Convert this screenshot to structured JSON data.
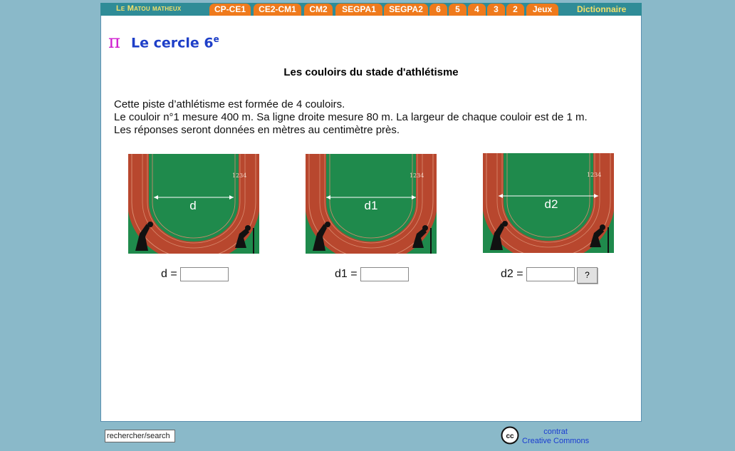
{
  "nav": {
    "site": "Le Matou matheux",
    "tabs": [
      "CP-CE1",
      "CE2-CM1",
      "CM2",
      "SEGPA1",
      "SEGPA2",
      "6",
      "5",
      "4",
      "3",
      "2",
      "Jeux"
    ],
    "dictionary": "Dictionnaire"
  },
  "page": {
    "pi_symbol": "π",
    "title": "Le cercle 6",
    "title_sup": "e",
    "subtitle": "Les couloirs du stade d'athlétisme",
    "lines": [
      "Cette piste d’athlétisme est formée de 4 couloirs.",
      "Le couloir n°1 mesure 400 m. Sa ligne droite mesure 80 m. La largeur de chaque couloir est de 1 m.",
      "Les réponses seront données en mètres au centimètre près."
    ]
  },
  "figures": [
    {
      "label": "d",
      "lanes": "1234"
    },
    {
      "label": "d1",
      "lanes": "1234"
    },
    {
      "label": "d2",
      "lanes": "1234"
    }
  ],
  "answers": [
    {
      "label": "d =",
      "value": ""
    },
    {
      "label": "d1 =",
      "value": ""
    },
    {
      "label": "d2 =",
      "value": ""
    }
  ],
  "check_button": "?",
  "footer": {
    "search_value": "rechercher/search",
    "cc_badge": "cc",
    "cc_line1": "contrat",
    "cc_line2": "Creative Commons"
  },
  "colors": {
    "accent_orange": "#ef7a1c",
    "nav_teal": "#2f8c97",
    "background": "#8ab9c9",
    "field_green": "#1f8a4c",
    "track_red": "#b8472e"
  }
}
